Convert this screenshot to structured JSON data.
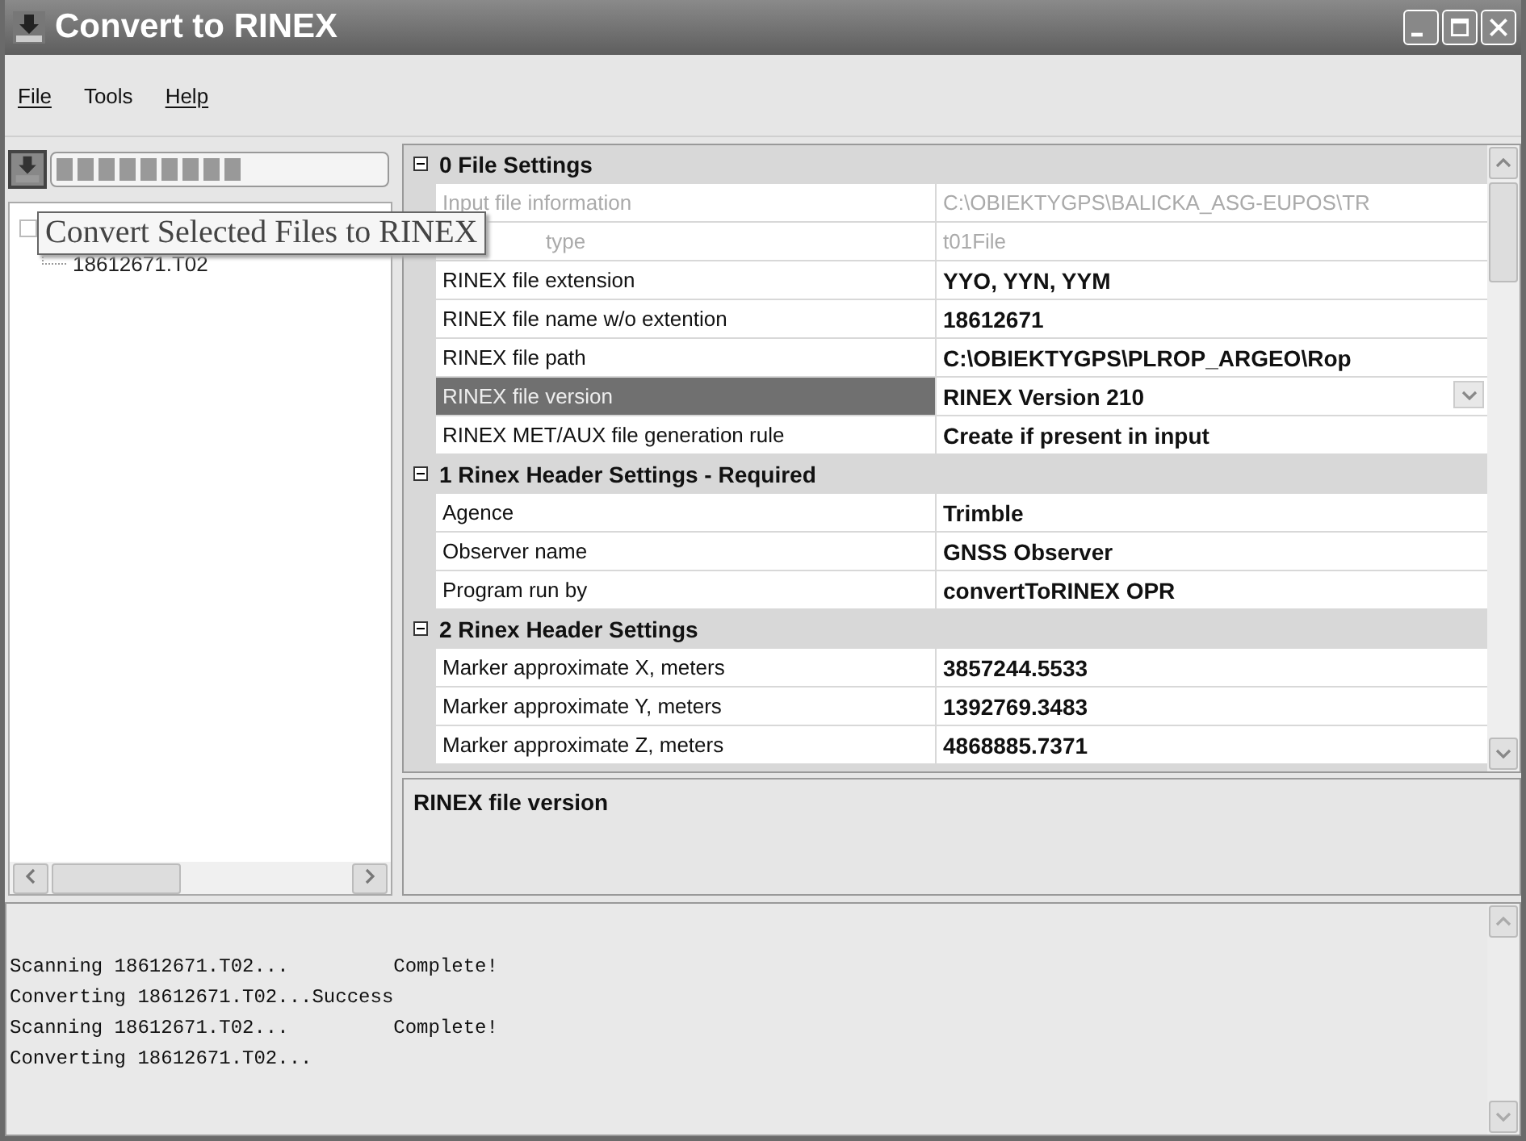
{
  "window": {
    "title": "Convert to RINEX"
  },
  "menu": [
    {
      "label": "File",
      "mnemonic": true
    },
    {
      "label": "Tools",
      "mnemonic": false
    },
    {
      "label": "Help",
      "mnemonic": true
    }
  ],
  "toolbar": {
    "progress": {
      "level": 0.57
    }
  },
  "tree": {
    "items": [
      {
        "children": [
          {
            "label": "18612671.T02"
          }
        ]
      }
    ]
  },
  "tooltip": "Convert Selected Files to RINEX",
  "grid": {
    "rows": [
      {
        "kind": "category",
        "label": "0 File Settings",
        "expanded": true
      },
      {
        "kind": "property",
        "label": "Input file information",
        "value": "C:\\OBIEKTYGPS\\BALICKA_ASG-EUPOS\\TR",
        "disabled": true,
        "selected": false,
        "covered": false
      },
      {
        "kind": "property",
        "label": "type",
        "value": "t01File",
        "disabled": true,
        "selected": false,
        "covered": true
      },
      {
        "kind": "property",
        "label": "RINEX file extension",
        "value": "YYO, YYN, YYM",
        "disabled": false,
        "selected": false,
        "covered": false
      },
      {
        "kind": "property",
        "label": "RINEX file name w/o extention",
        "value": "18612671",
        "disabled": false,
        "selected": false,
        "covered": false
      },
      {
        "kind": "property",
        "label": "RINEX file path",
        "value": "C:\\OBIEKTYGPS\\PLROP_ARGEO\\Rop",
        "disabled": false,
        "selected": false,
        "covered": false
      },
      {
        "kind": "property",
        "label": "RINEX file version",
        "value": "RINEX Version 210",
        "disabled": false,
        "selected": true,
        "covered": false,
        "dropdown": true
      },
      {
        "kind": "property",
        "label": "RINEX MET/AUX file generation rule",
        "value": "Create if present in input",
        "disabled": false,
        "selected": false,
        "covered": false
      },
      {
        "kind": "category",
        "label": "1 Rinex Header Settings - Required",
        "expanded": true
      },
      {
        "kind": "property",
        "label": "Agence",
        "value": "Trimble",
        "disabled": false,
        "selected": false,
        "covered": false
      },
      {
        "kind": "property",
        "label": "Observer name",
        "value": "GNSS Observer",
        "disabled": false,
        "selected": false,
        "covered": false
      },
      {
        "kind": "property",
        "label": "Program run by",
        "value": "convertToRINEX OPR",
        "disabled": false,
        "selected": false,
        "covered": false
      },
      {
        "kind": "category",
        "label": "2 Rinex Header Settings",
        "expanded": true
      },
      {
        "kind": "property",
        "label": "Marker approximate X, meters",
        "value": "3857244.5533",
        "disabled": false,
        "selected": false,
        "covered": false
      },
      {
        "kind": "property",
        "label": "Marker approximate Y, meters",
        "value": "1392769.3483",
        "disabled": false,
        "selected": false,
        "covered": false
      },
      {
        "kind": "property",
        "label": "Marker approximate Z, meters",
        "value": "4868885.7371",
        "disabled": false,
        "selected": false,
        "covered": false
      }
    ]
  },
  "description": {
    "title": "RINEX file version"
  },
  "log": [
    "Scanning 18612671.T02...         Complete!",
    "Converting 18612671.T02...Success",
    "Scanning 18612671.T02...         Complete!",
    "Converting 18612671.T02..."
  ]
}
